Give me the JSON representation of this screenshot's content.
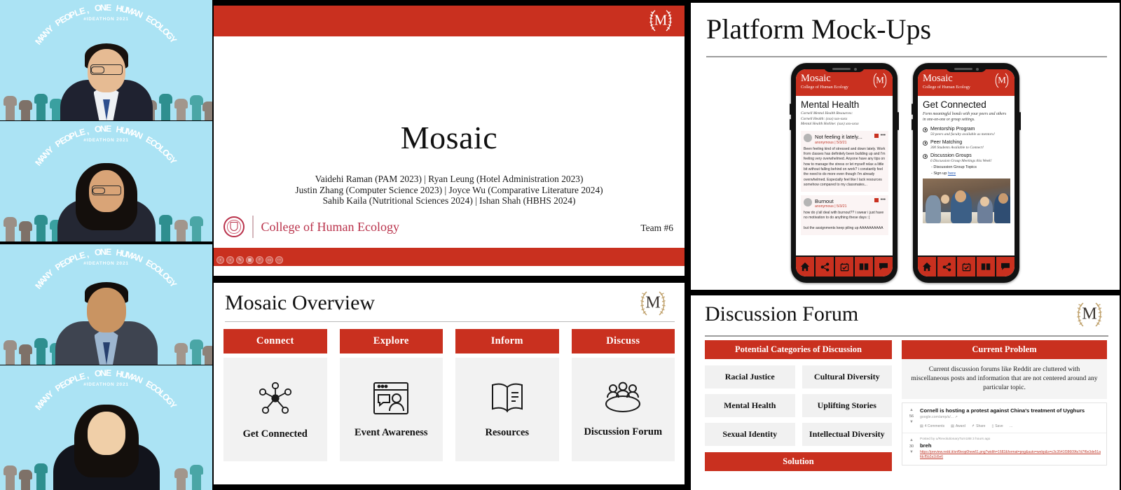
{
  "meeting": {
    "participants": [
      {
        "name": "participant-1",
        "background_text": "MANY PEOPLE, ONE HUMAN ECOLOGY",
        "background_subtext": "#IDEATHON 2021"
      },
      {
        "name": "participant-2",
        "background_text": "MANY PEOPLE, ONE HUMAN ECOLOGY",
        "background_subtext": "#IDEATHON 2021"
      },
      {
        "name": "participant-3",
        "background_text": "MANY PEOPLE, ONE HUMAN ECOLOGY",
        "background_subtext": "#IDEATHON 2021"
      },
      {
        "name": "participant-4",
        "background_text": "MANY PEOPLE, ONE HUMAN ECOLOGY",
        "background_subtext": "#IDEATHON 2021"
      }
    ]
  },
  "colors": {
    "brand_red": "#c9301f",
    "cornell_red": "#b9314a",
    "card_gray": "#f2f2f2",
    "video_bg_blue": "#abe3f4"
  },
  "title_slide": {
    "logo_letter": "M",
    "title": "Mosaic",
    "authors_lines": [
      "Vaidehi Raman (PAM 2023) | Ryan Leung (Hotel Administration 2023)",
      "Justin Zhang (Computer Science 2023) | Joyce Wu (Comparative Literature 2024)",
      "Sahib Kaila (Nutritional Sciences 2024) | Ishan Shah (HBHS 2024)"
    ],
    "footer_org": "College of Human Ecology",
    "team_label": "Team #6",
    "toolbar_icons": [
      "prev-slide-icon",
      "next-slide-icon",
      "pen-icon",
      "all-slides-icon",
      "zoom-icon",
      "blank-screen-icon",
      "more-options-icon"
    ]
  },
  "overview_slide": {
    "title": "Mosaic Overview",
    "logo_letter": "M",
    "columns": [
      {
        "category": "Connect",
        "icon": "network-nodes-icon",
        "label": "Get Connected"
      },
      {
        "category": "Explore",
        "icon": "browser-chat-icon",
        "label": "Event Awareness"
      },
      {
        "category": "Inform",
        "icon": "open-book-icon",
        "label": "Resources"
      },
      {
        "category": "Discuss",
        "icon": "group-people-icon",
        "label": "Discussion Forum"
      }
    ]
  },
  "mockups_slide": {
    "title": "Platform Mock-Ups",
    "phones": [
      {
        "brand": "Mosaic",
        "brand_sub": "College of Human Ecology",
        "logo_letter": "M",
        "screen_title": "Mental Health",
        "resources": [
          "Cornell Mental Health Resources:",
          "Cornell Health: (xxx) xxx-xxxx",
          "Mental Health Hotline: (xxx) xxx-xxxx"
        ],
        "posts": [
          {
            "title": "Not feeling it lately...",
            "meta": "anonymous | 5/3/21",
            "body": "Been feeling kind of stressed and down lately. Work from classes has definitely been building up and I'm feeling very overwhelmed. Anyone have any tips on how to manage the stress or let myself relax a little bit without falling behind on work? i constantly feel the need to do more even though I'm already overwhelmed. Especially feel like I lack resources somehow compared to my classmates..."
          },
          {
            "title": "Burnout",
            "meta": "anonymous | 5/3/21",
            "body": "how do y'all deal with burnout?? i swear i just have no motivation to do anything these days :(\n\nbut the assignments keep piling up AAAAAAAAAA"
          }
        ],
        "nav_icons": [
          "home-icon",
          "share-icon",
          "calendar-check-icon",
          "book-icon",
          "chat-icon"
        ]
      },
      {
        "brand": "Mosaic",
        "brand_sub": "College of Human Ecology",
        "logo_letter": "M",
        "screen_title": "Get Connected",
        "description": "Form meaningful bonds with your peers and others in one-on-one or group settings.",
        "items": [
          {
            "name": "Mentorship Program",
            "note": "50 peers and faculty available as mentors!"
          },
          {
            "name": "Peer Matching",
            "note": "300 Students Available to Connect!"
          },
          {
            "name": "Discussion Groups",
            "note": "6 Discussion Group Meetings this Week!"
          }
        ],
        "sub_links": [
          {
            "text": "- Discussion Group Topics",
            "link": ""
          },
          {
            "text": "- Sign up ",
            "link": "here"
          }
        ],
        "photo_caption": "students-collaborating-photo",
        "nav_icons": [
          "home-icon",
          "share-icon",
          "calendar-check-icon",
          "book-icon",
          "chat-icon"
        ]
      }
    ]
  },
  "forum_slide": {
    "title": "Discussion Forum",
    "logo_letter": "M",
    "categories_banner": "Potential Categories of Discussion",
    "categories": [
      "Racial Justice",
      "Cultural Diversity",
      "Mental Health",
      "Uplifting Stories",
      "Sexual Identity",
      "Intellectual Diversity"
    ],
    "solution_banner": "Solution",
    "problem_banner": "Current Problem",
    "problem_text": "Current discussion forums like Reddit are cluttered with miscellaneous posts and information that are not centered around any particular topic.",
    "reddit_posts": [
      {
        "votes": "56",
        "title": "Cornell is hosting a protest against China's treatment of Uyghurs",
        "link": "google.com/amp/s/...",
        "actions": [
          "4 Comments",
          "Award",
          "Share",
          "Save",
          "…"
        ]
      },
      {
        "votes": "30",
        "byline": "Posted by u/RevolutionaryTurn188 3 hours ago",
        "title": "breh",
        "url": "https://preview.redd.it/snf9eop0hew61.png?width=1682&format=png&auto=webp&s=c3c3541f38609fa7d7f6e3de51afdcf5b2a1b5e6"
      }
    ]
  }
}
